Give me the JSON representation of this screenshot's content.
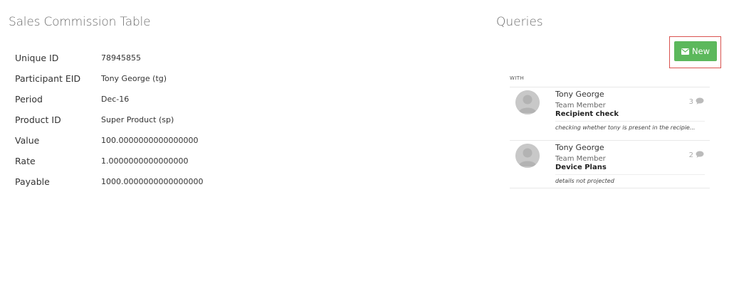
{
  "left_panel": {
    "title": "Sales Commission Table",
    "rows": [
      {
        "label": "Unique ID",
        "value": "78945855"
      },
      {
        "label": "Participant EID",
        "value": "Tony George (tg)"
      },
      {
        "label": "Period",
        "value": "Dec-16"
      },
      {
        "label": "Product ID",
        "value": "Super Product (sp)"
      },
      {
        "label": "Value",
        "value": "100.0000000000000000"
      },
      {
        "label": "Rate",
        "value": "1.0000000000000000"
      },
      {
        "label": "Payable",
        "value": "1000.0000000000000000"
      }
    ]
  },
  "right_panel": {
    "title": "Queries",
    "new_button": {
      "label": "New",
      "icon": "envelope-icon"
    },
    "with_label": "WITH",
    "queries": [
      {
        "name": "Tony George",
        "role": "Team Member",
        "subject": "Recipient check",
        "count": "3",
        "preview": "checking whether tony is present in the recipie..."
      },
      {
        "name": "Tony George",
        "role": "Team Member",
        "subject": "Device Plans",
        "count": "2",
        "preview": "details not projected"
      }
    ]
  },
  "colors": {
    "accent_green": "#5cb85c",
    "highlight_red": "#d9534f"
  }
}
